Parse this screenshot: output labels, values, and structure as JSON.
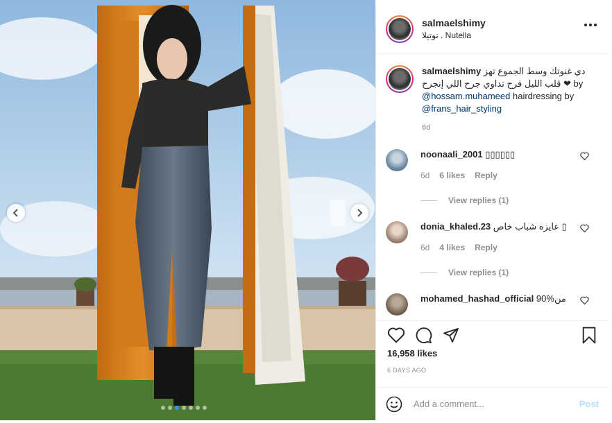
{
  "post": {
    "username": "salmaelshimy",
    "location": "نوتيلا . Nutella",
    "more_icon": "more-horizontal-icon"
  },
  "caption": {
    "username": "salmaelshimy",
    "text_line1": "دي غنوتك وسط الجموع تهز",
    "text_line2": "قلب الليل فرح تداوي جرح اللي إنجرح ❤ by",
    "mention1": "@hossam.muhameed",
    "text_mid": " hairdressing by",
    "mention2": "@frans_hair_styling",
    "time": "6d"
  },
  "comments": [
    {
      "username": "noonaali_2001",
      "text": "▯▯▯▯▯▯",
      "time": "6d",
      "likes": "6 likes",
      "reply_label": "Reply",
      "view_replies": "View replies (1)",
      "avatar_color": "#6f8fa8"
    },
    {
      "username": "donia_khaled.23",
      "text": "عايزه شباب خاص ▯",
      "time": "6d",
      "likes": "4 likes",
      "reply_label": "Reply",
      "view_replies": "View replies (1)",
      "avatar_color": "#a58a7a"
    },
    {
      "username": "mohamed_hashad_official",
      "text": "90%من",
      "avatar_color": "#7a6a5a"
    }
  ],
  "actions": {
    "like_icon": "heart-icon",
    "comment_icon": "comment-icon",
    "share_icon": "share-icon",
    "save_icon": "bookmark-icon"
  },
  "likes_count": "16,958 likes",
  "post_date": "6 DAYS AGO",
  "add_comment": {
    "emoji_icon": "emoji-icon",
    "placeholder": "Add a comment...",
    "post_label": "Post"
  },
  "carousel": {
    "slides": 7,
    "active_index": 2
  },
  "colors": {
    "link": "#00376b",
    "muted": "#8e8e8e",
    "post_disabled": "#b2dffc",
    "active_dot": "#3897f0"
  }
}
